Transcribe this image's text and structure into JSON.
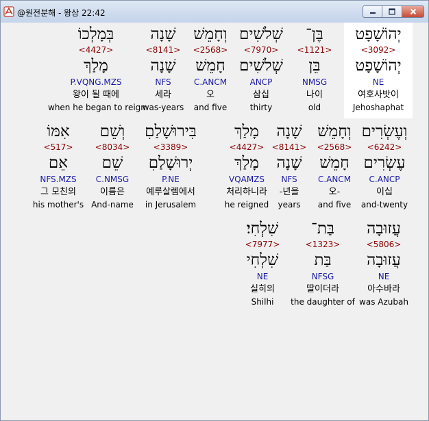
{
  "window": {
    "title": "@원전분해 - 왕상 22:42",
    "buttons": [
      "minimize",
      "maximize",
      "close"
    ]
  },
  "rows": [
    [
      {
        "hebrew": "יְהוֹשָׁפָט",
        "strong": "<3092>",
        "lemma": "יְהוֹשָׁפָט",
        "parse": "NE",
        "korean": "여호사밧이",
        "english": "Jehoshaphat",
        "highlight": true
      },
      {
        "hebrew": "בֶּן־",
        "strong": "<1121>",
        "lemma": "בֵּן",
        "parse": "NMSG",
        "korean": "나이",
        "english": "old"
      },
      {
        "hebrew": "שְׁלֹשִׁים",
        "strong": "<7970>",
        "lemma": "שְׁלֹשִׁים",
        "parse": "ANCP",
        "korean": "삼십",
        "english": "thirty"
      },
      {
        "hebrew": "וְחָמֵשׁ",
        "strong": "<2568>",
        "lemma": "חָמֵשׁ",
        "parse": "C.ANCM",
        "korean": "오",
        "english": "and five"
      },
      {
        "hebrew": "שָׁנָה",
        "strong": "<8141>",
        "lemma": "שָׁנָה",
        "parse": "NFS",
        "korean": "세라",
        "english": "was-years"
      },
      {
        "hebrew": "בְּמָלְכוֹ",
        "strong": "<4427>",
        "lemma": "מָלַךְ",
        "parse": "P.VQNG.MZS",
        "korean": "왕이 될 때에",
        "english": "when he began to reign"
      }
    ],
    [
      {
        "hebrew": "וְעֶשְׂרִים",
        "strong": "<6242>",
        "lemma": "עֶשְׂרִים",
        "parse": "C.ANCP",
        "korean": "이십",
        "english": "and-twenty"
      },
      {
        "hebrew": "וְחָמֵשׁ",
        "strong": "<2568>",
        "lemma": "חָמֵשׁ",
        "parse": "C.ANCM",
        "korean": "오-",
        "english": "and five"
      },
      {
        "hebrew": "שָׁנָה",
        "strong": "<8141>",
        "lemma": "שָׁנָה",
        "parse": "NFS",
        "korean": "-년을",
        "english": "years"
      },
      {
        "hebrew": "מָלַךְ",
        "strong": "<4427>",
        "lemma": "מָלַךְ",
        "parse": "VQAMZS",
        "korean": "처리하니라",
        "english": "he reigned"
      },
      {
        "hebrew": "בִּירוּשָׁלַםִ",
        "strong": "<3389>",
        "lemma": "יְרוּשָׁלַםִ",
        "parse": "P.NE",
        "korean": "예루살렘에서",
        "english": "in Jerusalem"
      },
      {
        "hebrew": "וְשֵׁם",
        "strong": "<8034>",
        "lemma": "שֵׁם",
        "parse": "C.NMSG",
        "korean": "이름은",
        "english": "And-name"
      },
      {
        "hebrew": "אִמּוֹ",
        "strong": "<517>",
        "lemma": "אֵם",
        "parse": "NFS.MZS",
        "korean": "그 모친의",
        "english": "his mother's"
      }
    ],
    [
      {
        "hebrew": "עֲזוּבָה",
        "strong": "<5806>",
        "lemma": "עֲזוּבָה",
        "parse": "NE",
        "korean": "아수바라",
        "english": "was Azubah"
      },
      {
        "hebrew": "בַּת־",
        "strong": "<1323>",
        "lemma": "בַּת",
        "parse": "NFSG",
        "korean": "딸이더라",
        "english": "the daughter of"
      },
      {
        "hebrew": "שִׁלְחִי׃",
        "strong": "<7977>",
        "lemma": "שִׁלְחִי",
        "parse": "NE",
        "korean": "실히의",
        "english": "Shilhi"
      }
    ]
  ]
}
